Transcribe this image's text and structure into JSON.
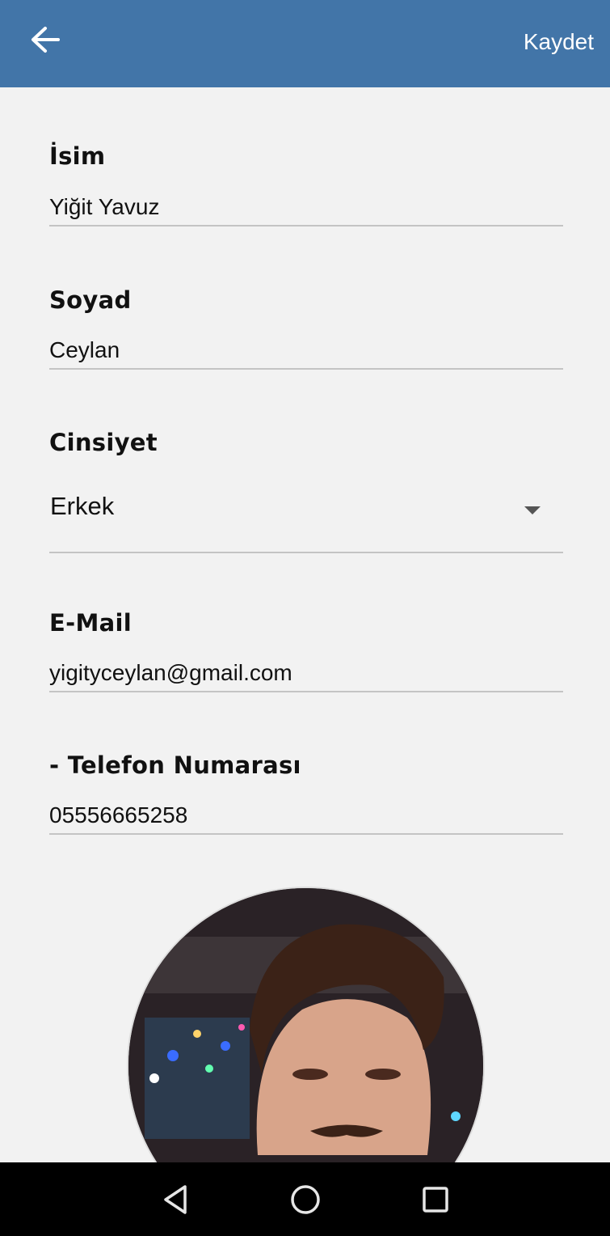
{
  "appbar": {
    "save_label": "Kaydet",
    "background_color": "#4275a8",
    "back_icon": "arrow-left-icon"
  },
  "form": {
    "name": {
      "label": "İsim",
      "value": "Yiğit Yavuz"
    },
    "surname": {
      "label": "Soyad",
      "value": "Ceylan"
    },
    "gender": {
      "label": "Cinsiyet",
      "selected": "Erkek"
    },
    "email": {
      "label": "E-Mail",
      "value": "yigityceylan@gmail.com"
    },
    "phone": {
      "label": "- Telefon Numarası",
      "value": "05556665258"
    }
  },
  "navbar": {
    "icons": [
      "back-triangle-icon",
      "home-circle-icon",
      "recents-square-icon"
    ]
  }
}
